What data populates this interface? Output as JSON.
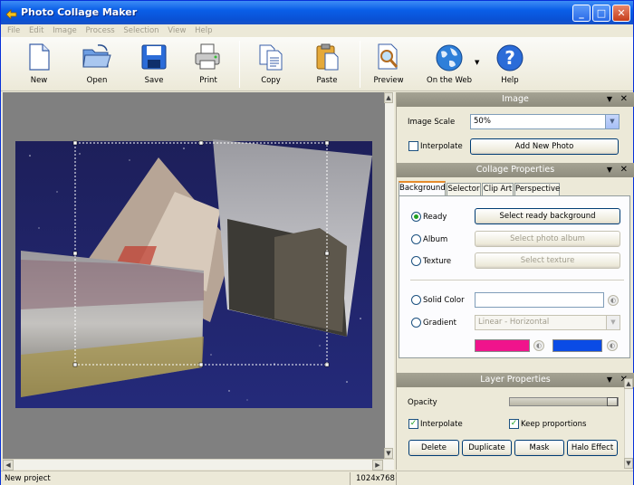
{
  "window": {
    "title": "Photo Collage Maker"
  },
  "menu": [
    "File",
    "Edit",
    "Image",
    "Process",
    "Selection",
    "View",
    "Help"
  ],
  "toolbar": {
    "new": "New",
    "open": "Open",
    "save": "Save",
    "print": "Print",
    "copy": "Copy",
    "paste": "Paste",
    "preview": "Preview",
    "on_the_web": "On the Web",
    "help": "Help"
  },
  "image_panel": {
    "title": "Image",
    "image_scale_label": "Image Scale",
    "image_scale_value": "50%",
    "interpolate_label": "Interpolate",
    "interpolate_checked": false,
    "add_new_photo": "Add New Photo"
  },
  "collage_panel": {
    "title": "Collage Properties",
    "tabs": [
      "Background",
      "Selector",
      "Clip Art",
      "Perspective"
    ],
    "active_tab": "Background",
    "ready_label": "Ready",
    "select_ready_background": "Select ready background",
    "album_label": "Album",
    "select_photo_album": "Select photo album",
    "texture_label": "Texture",
    "select_texture": "Select texture",
    "solid_color_label": "Solid Color",
    "gradient_label": "Gradient",
    "gradient_value": "Linear - Horizontal",
    "gradient_color_1": "#f0148c",
    "gradient_color_2": "#0a4be6"
  },
  "layer_panel": {
    "title": "Layer Properties",
    "opacity_label": "Opacity",
    "opacity_value": 1.0,
    "interpolate_label": "Interpolate",
    "interpolate_checked": true,
    "keep_proportions_label": "Keep proportions",
    "keep_proportions_checked": true,
    "delete": "Delete",
    "duplicate": "Duplicate",
    "mask": "Mask",
    "halo_effect": "Halo Effect"
  },
  "status": {
    "project": "New project",
    "size": "1024x768"
  }
}
